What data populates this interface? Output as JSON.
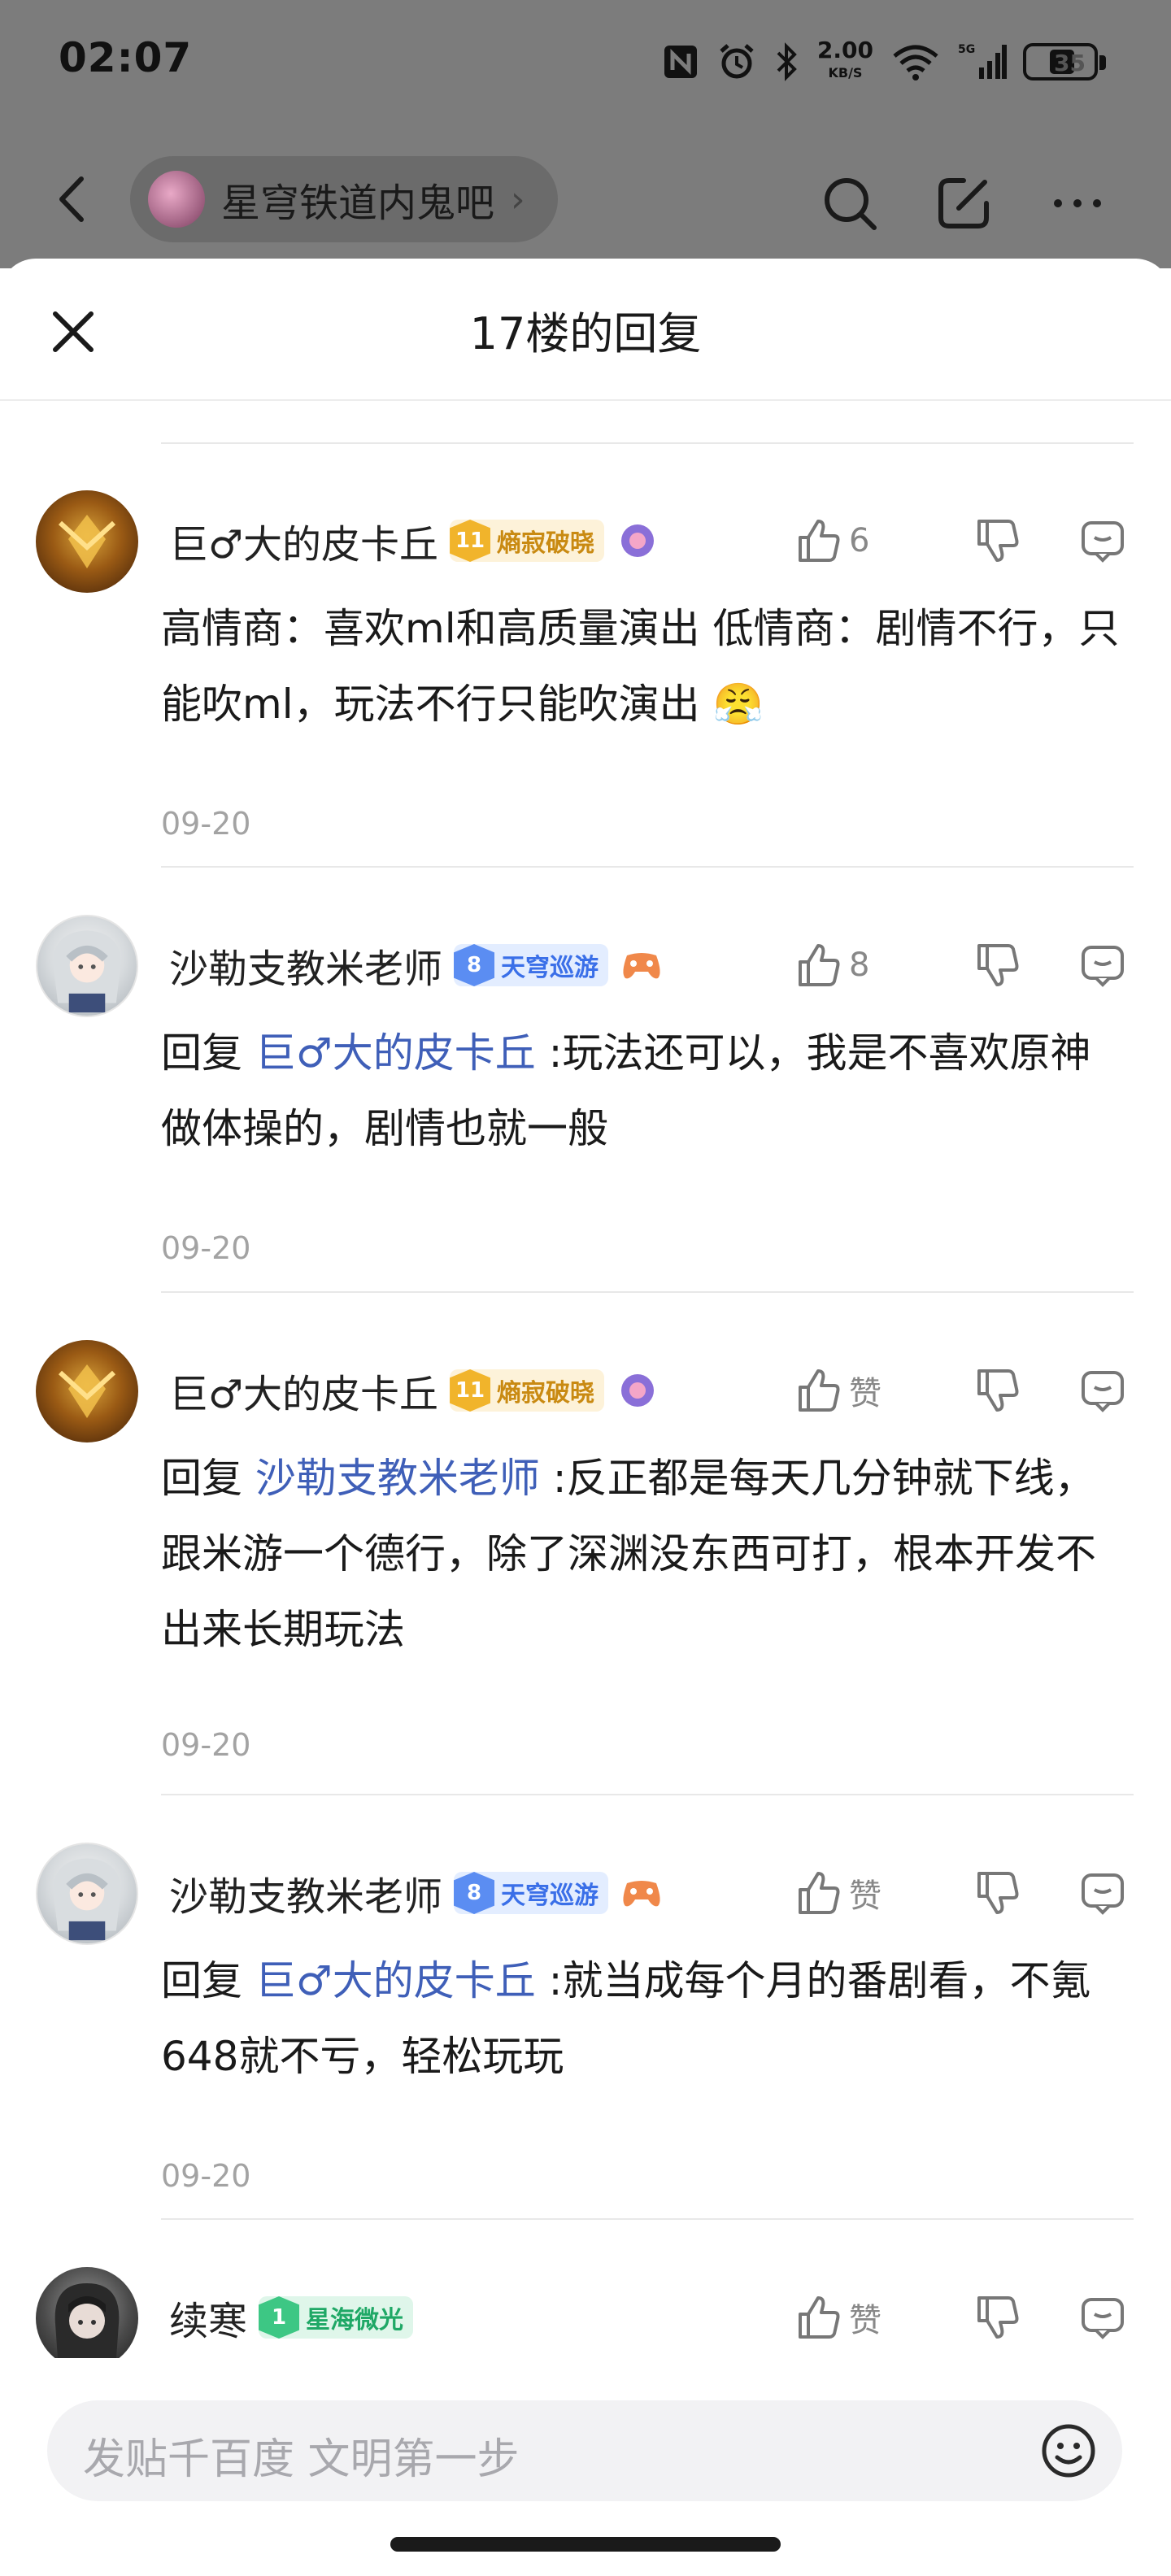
{
  "status_bar": {
    "time": "02:07",
    "net_speed_value": "2.00",
    "net_speed_unit": "KB/S",
    "signal_label": "5G",
    "battery": "35"
  },
  "topnav": {
    "forum_name": "星穹铁道内鬼吧"
  },
  "sheet": {
    "title": "17楼的回复"
  },
  "replies": [
    {
      "username": "巨♂大的皮卡丘",
      "level": "11",
      "badge": "熵寂破晓",
      "badge_color": "gold",
      "likes": "6",
      "reply_prefix": "",
      "mention": "",
      "text": "高情商：喜欢ml和高质量演出 低情商：剧情不行，只能吹ml，玩法不行只能吹演出 😤",
      "date": "09-20"
    },
    {
      "username": "沙勒支教米老师",
      "level": "8",
      "badge": "天穹巡游",
      "badge_color": "blue",
      "likes": "8",
      "reply_prefix": "回复 ",
      "mention": "巨♂大的皮卡丘",
      "text": " :玩法还可以，我是不喜欢原神做体操的，剧情也就一般",
      "date": "09-20"
    },
    {
      "username": "巨♂大的皮卡丘",
      "level": "11",
      "badge": "熵寂破晓",
      "badge_color": "gold",
      "likes": "赞",
      "reply_prefix": "回复 ",
      "mention": "沙勒支教米老师",
      "text": " :反正都是每天几分钟就下线，跟米游一个德行，除了深渊没东西可打，根本开发不出来长期玩法",
      "date": "09-20"
    },
    {
      "username": "沙勒支教米老师",
      "level": "8",
      "badge": "天穹巡游",
      "badge_color": "blue",
      "likes": "赞",
      "reply_prefix": "回复 ",
      "mention": "巨♂大的皮卡丘",
      "text": " :就当成每个月的番剧看，不氪648就不亏，轻松玩玩",
      "date": "09-20"
    },
    {
      "username": "续寒",
      "level": "1",
      "badge": "星海微光",
      "badge_color": "green",
      "likes": "赞"
    }
  ],
  "input": {
    "placeholder": "发贴千百度 文明第一步"
  },
  "colors": {
    "mention": "#3f5fb8",
    "badge_gold": "#f1b42b",
    "badge_blue": "#5b8df2",
    "badge_green": "#3dc784"
  }
}
